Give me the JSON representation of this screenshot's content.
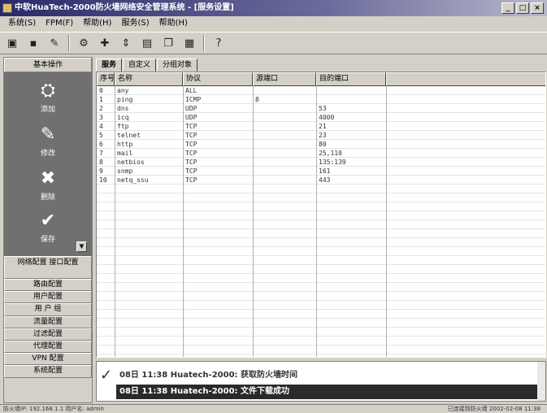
{
  "window": {
    "title": "中软HuaTech-2000防火墙网络安全管理系统 - [服务设置]",
    "controls": [
      "_",
      "□",
      "×"
    ]
  },
  "menu": [
    "系统(S)",
    "FPM(F)",
    "帮助(H)",
    "服务(S)",
    "帮助(H)"
  ],
  "toolbar": {
    "icons": [
      "folder-open-icon",
      "save-icon",
      "find-icon",
      "gear-icon",
      "add-icon",
      "move-icon",
      "document-icon",
      "copy-icon",
      "grid-icon",
      "help-icon"
    ],
    "glyphs": [
      "▣",
      "▪",
      "✎",
      "⚙",
      "✚",
      "⇕",
      "▤",
      "❐",
      "▦",
      "?"
    ]
  },
  "sidebar": {
    "header": "基本操作",
    "tools": [
      {
        "label": "添加",
        "icon": "add-tool-icon"
      },
      {
        "label": "修改",
        "icon": "edit-tool-icon"
      },
      {
        "label": "删除",
        "icon": "delete-tool-icon"
      },
      {
        "label": "保存",
        "icon": "save-tool-icon"
      }
    ],
    "groups": [
      "网络配置 接口配置",
      "路由配置",
      "用户配置",
      "用 户 组",
      "流量配置",
      "过滤配置",
      "代理配置",
      "VPN 配置",
      "系统配置"
    ]
  },
  "tabs": [
    "服务",
    "自定义",
    "分组对象"
  ],
  "table": {
    "columns": [
      "序号",
      "名称",
      "协议",
      "源端口",
      "目的端口"
    ],
    "rows": [
      [
        "0",
        "any",
        "ALL",
        "",
        ""
      ],
      [
        "1",
        "ping",
        "ICMP",
        "8",
        ""
      ],
      [
        "2",
        "dns",
        "UDP",
        "",
        "53"
      ],
      [
        "3",
        "icq",
        "UDP",
        "",
        "4000"
      ],
      [
        "4",
        "ftp",
        "TCP",
        "",
        "21"
      ],
      [
        "5",
        "telnet",
        "TCP",
        "",
        "23"
      ],
      [
        "6",
        "http",
        "TCP",
        "",
        "80"
      ],
      [
        "7",
        "mail",
        "TCP",
        "",
        "25,110"
      ],
      [
        "8",
        "netbios",
        "TCP",
        "",
        "135:139"
      ],
      [
        "9",
        "snmp",
        "TCP",
        "",
        "161"
      ],
      [
        "10",
        "netq_ssu",
        "TCP",
        "",
        "443"
      ]
    ]
  },
  "log": {
    "line1": "08日 11:38  Huatech-2000: 获取防火墙时间",
    "line2": "08日 11:38  Huatech-2000: 文件下载成功"
  },
  "status": {
    "left": "防火墙IP: 192.168.1.1  用户名: admin",
    "right": "已连接到防火墙  2002-02-08  11:38"
  }
}
